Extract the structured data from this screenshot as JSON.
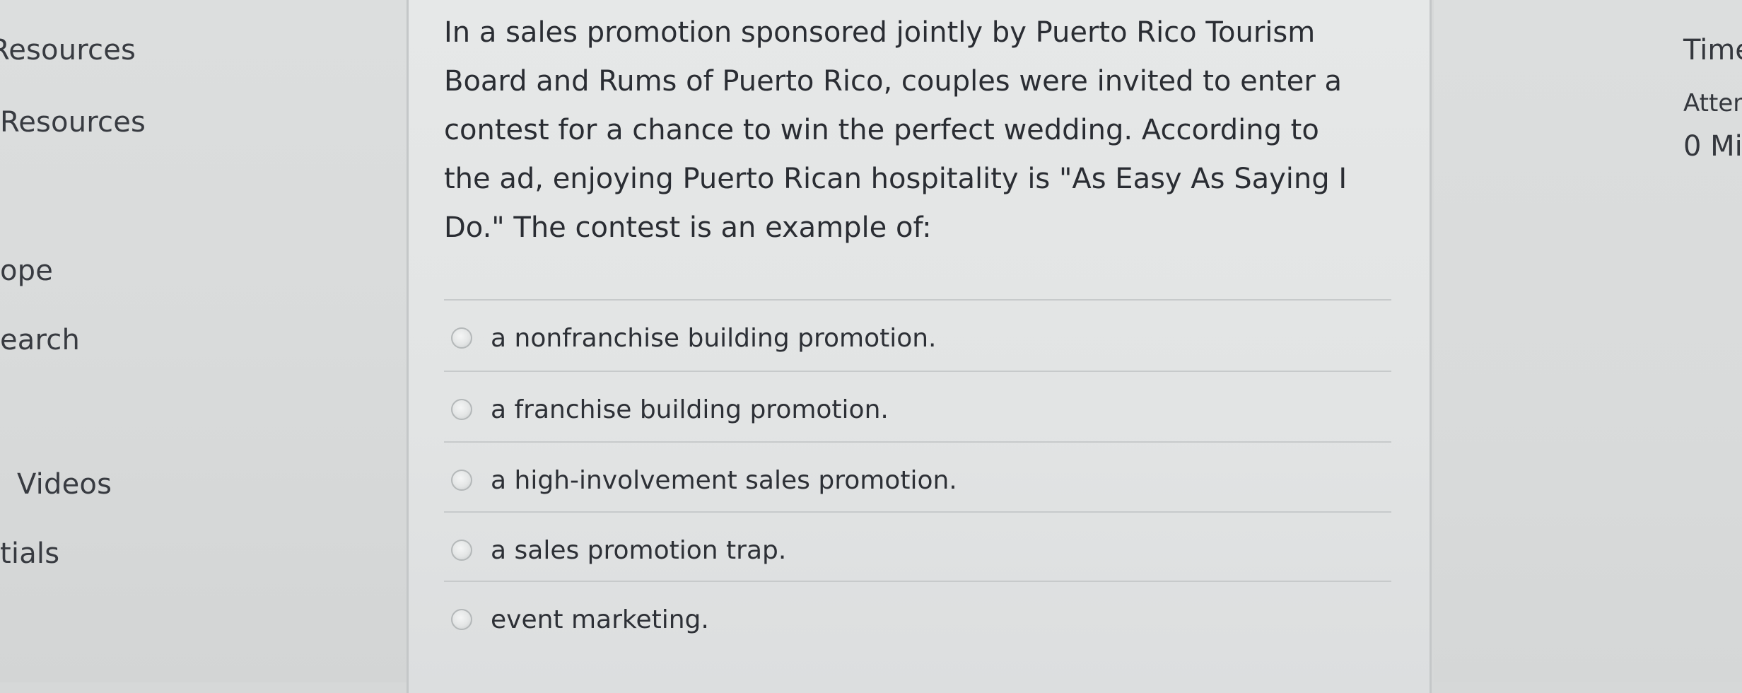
{
  "sidebar": {
    "items": [
      {
        "label": "Resources"
      },
      {
        "label": "Resources"
      },
      {
        "label": "ope"
      },
      {
        "label": "earch"
      },
      {
        "label": "Videos"
      },
      {
        "label": "tials"
      }
    ]
  },
  "question": {
    "text": "In a sales promotion sponsored jointly by Puerto Rico Tourism Board and Rums of Puerto Rico, couples were invited to enter a contest for a chance to win the perfect wedding. According to the ad, enjoying Puerto Rican hospitality is \"As Easy As Saying I Do.\" The contest is an example of:",
    "answers": [
      {
        "label": "a nonfranchise building promotion."
      },
      {
        "label": "a franchise building promotion."
      },
      {
        "label": "a high-involvement sales promotion."
      },
      {
        "label": "a sales promotion trap."
      },
      {
        "label": "event marketing."
      }
    ]
  },
  "quiz_info": {
    "time_label": "Time",
    "attempt_label": "Atten",
    "minutes_text": "0 Mi"
  }
}
